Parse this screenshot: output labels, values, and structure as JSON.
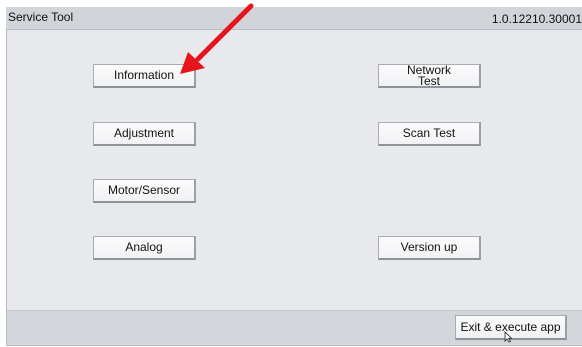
{
  "titlebar": {
    "app_title": "Service Tool",
    "version": "1.0.12210.30001"
  },
  "buttons": {
    "information": "Information",
    "adjustment": "Adjustment",
    "motor_sensor": "Motor/Sensor",
    "analog": "Analog",
    "network_test": "Network\nTest",
    "scan_test": "Scan Test",
    "version_up": "Version up"
  },
  "footer": {
    "exit_label": "Exit & execute app"
  },
  "overlay": {
    "arrow_color": "#e8141c"
  }
}
